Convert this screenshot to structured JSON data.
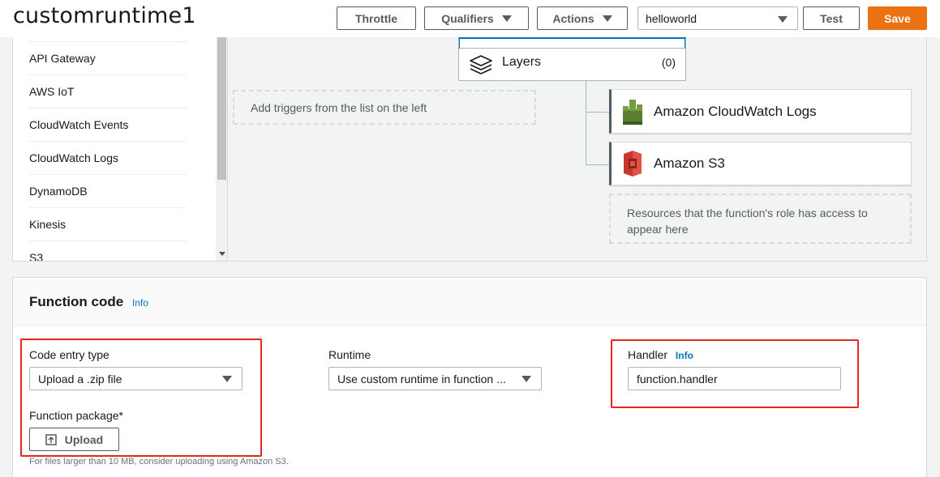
{
  "header": {
    "title": "customruntime1",
    "throttle_label": "Throttle",
    "qualifiers_label": "Qualifiers",
    "actions_label": "Actions",
    "test_event_value": "helloworld",
    "test_label": "Test",
    "save_label": "Save"
  },
  "designer": {
    "trigger_items": [
      {
        "label": "API Gateway"
      },
      {
        "label": "AWS IoT"
      },
      {
        "label": "CloudWatch Events"
      },
      {
        "label": "CloudWatch Logs"
      },
      {
        "label": "DynamoDB"
      },
      {
        "label": "Kinesis"
      },
      {
        "label": "S3"
      }
    ],
    "add_triggers_hint": "Add triggers from the list on the left",
    "layers_label": "Layers",
    "layers_count": "(0)",
    "resources": [
      {
        "label": "Amazon CloudWatch Logs",
        "icon": "cloudwatch-logs-icon"
      },
      {
        "label": "Amazon S3",
        "icon": "s3-bucket-icon"
      }
    ],
    "resources_hint": "Resources that the function's role has access to appear here"
  },
  "function_code": {
    "title": "Function code",
    "info_label": "Info",
    "code_entry_type_label": "Code entry type",
    "code_entry_type_value": "Upload a .zip file",
    "runtime_label": "Runtime",
    "runtime_value": "Use custom runtime in function ...",
    "handler_label": "Handler",
    "handler_info_label": "Info",
    "handler_value": "function.handler",
    "function_package_label": "Function package*",
    "upload_label": "Upload",
    "upload_hint": "For files larger than 10 MB, consider uploading using Amazon S3."
  },
  "colors": {
    "accent_orange": "#ec7211",
    "link_blue": "#0073bb",
    "highlight_red": "#e8261d",
    "cloudwatch_green": "#759c3e",
    "s3_red": "#c7372f"
  }
}
